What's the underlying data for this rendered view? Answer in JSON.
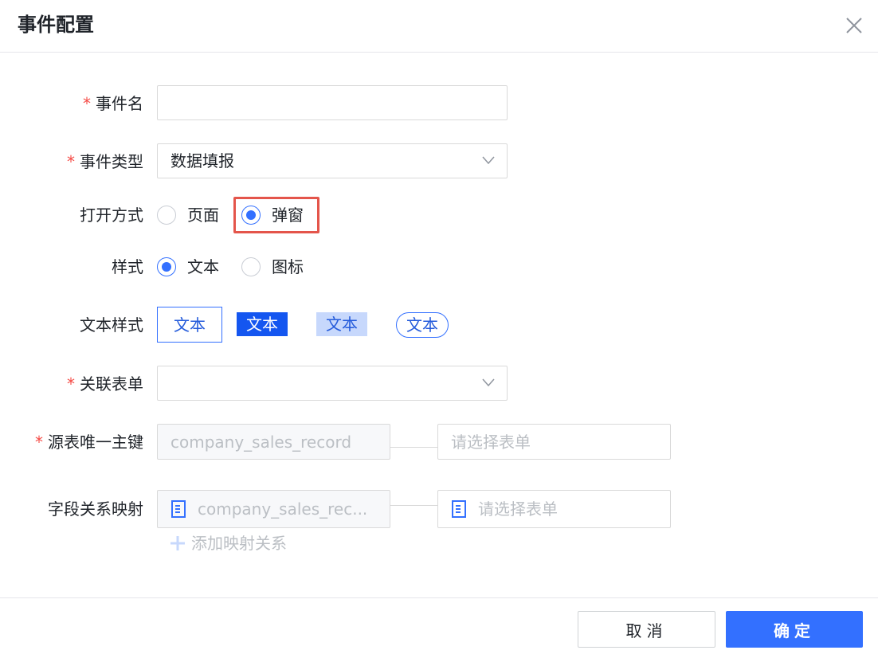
{
  "dialog": {
    "title": "事件配置"
  },
  "icons": {
    "close": "close-icon",
    "chevron": "chevron-down-icon",
    "document": "document-icon",
    "add": "plus-icon"
  },
  "colors": {
    "accent": "#3370ff",
    "required": "#f54a45",
    "highlight_box": "#e4554b"
  },
  "form": {
    "required_mark": "*",
    "event_name": {
      "label": "事件名",
      "value": ""
    },
    "event_type": {
      "label": "事件类型",
      "value": "数据填报"
    },
    "open_mode": {
      "label": "打开方式",
      "options": [
        "页面",
        "弹窗"
      ],
      "selected": "弹窗"
    },
    "style": {
      "label": "样式",
      "options": [
        "文本",
        "图标"
      ],
      "selected": "文本"
    },
    "text_style": {
      "label": "文本样式",
      "options": [
        "文本",
        "文本",
        "文本",
        "文本"
      ],
      "selected_index": 0
    },
    "linked_form": {
      "label": "关联表单",
      "value": ""
    },
    "source_key": {
      "label": "源表唯一主键",
      "source_value": "company_sales_record",
      "target_placeholder": "请选择表单"
    },
    "field_mapping": {
      "label": "字段关系映射",
      "source_value": "company_sales_rec...",
      "target_placeholder": "请选择表单",
      "add_label": "添加映射关系"
    }
  },
  "footer": {
    "cancel_label": "取消",
    "ok_label": "确定"
  }
}
